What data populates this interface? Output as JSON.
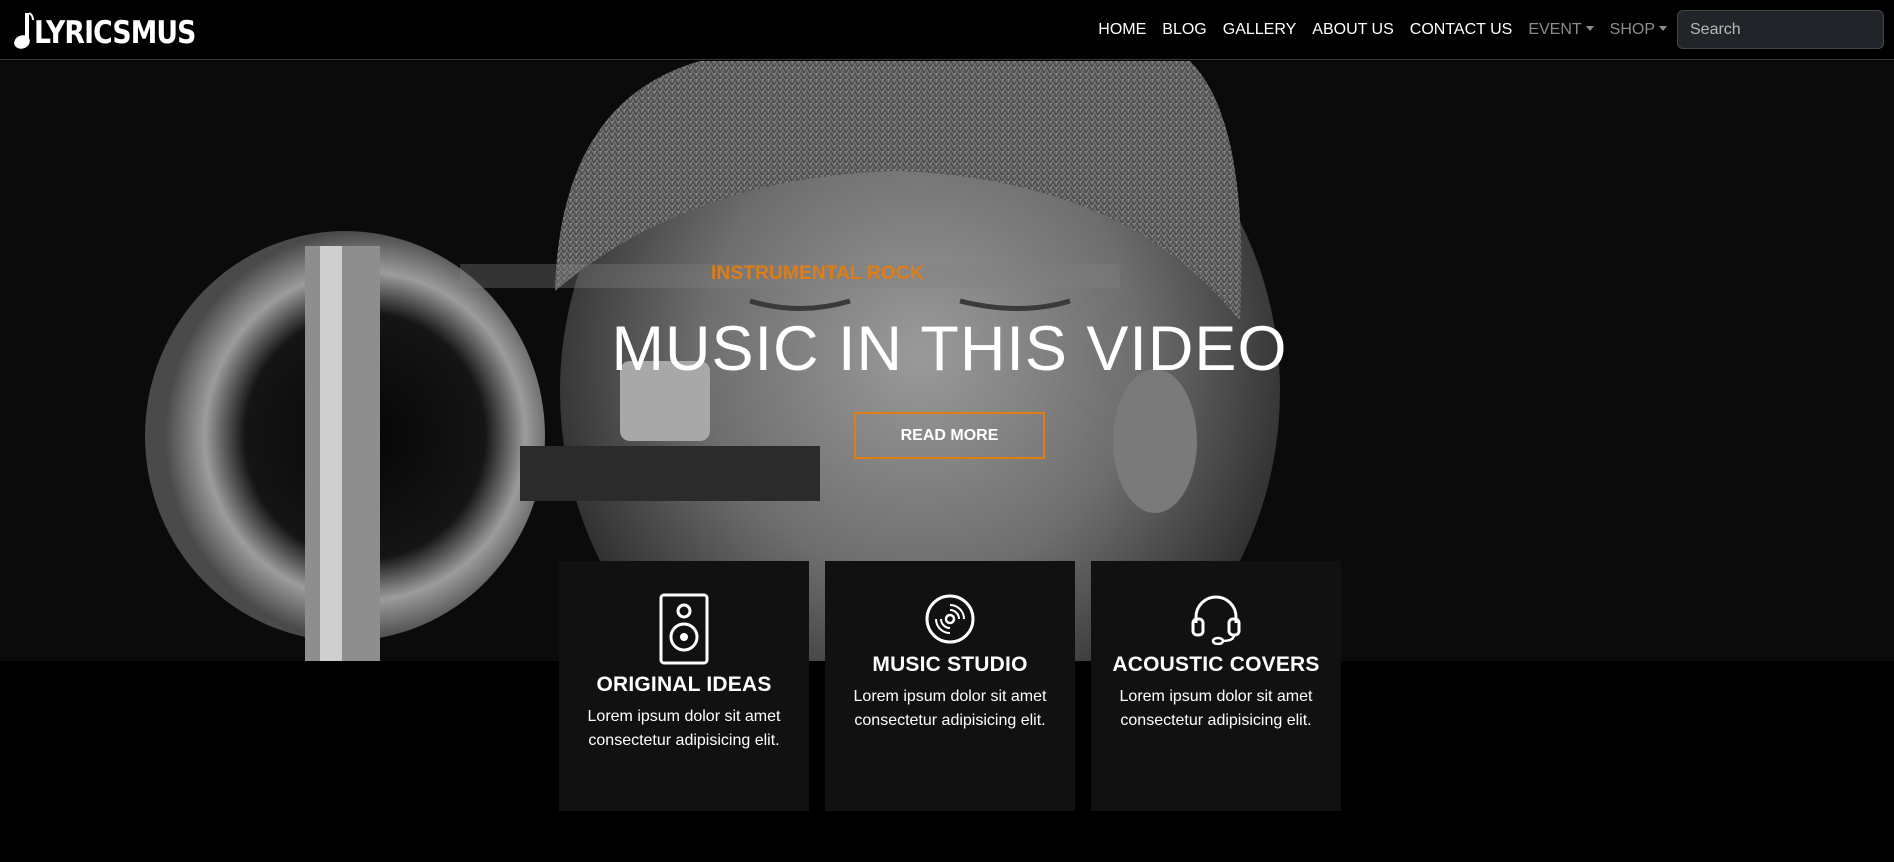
{
  "brand": {
    "name": "LYRICSMUS"
  },
  "nav": {
    "links": [
      {
        "label": "HOME"
      },
      {
        "label": "BLOG"
      },
      {
        "label": "GALLERY"
      },
      {
        "label": "ABOUT US"
      },
      {
        "label": "CONTACT US"
      }
    ],
    "dropdowns": [
      {
        "label": "EVENT"
      },
      {
        "label": "SHOP"
      }
    ],
    "search": {
      "placeholder": "Search"
    }
  },
  "hero": {
    "eyebrow": "INSTRUMENTAL ROCK",
    "title": "MUSIC IN THIS VIDEO",
    "button_label": "READ MORE",
    "accent_color": "#e07d14"
  },
  "features": [
    {
      "icon": "speaker-icon",
      "title": "ORIGINAL IDEAS",
      "text": "Lorem ipsum dolor sit amet consectetur adipisicing elit."
    },
    {
      "icon": "vinyl-disc-icon",
      "title": "MUSIC STUDIO",
      "text": "Lorem ipsum dolor sit amet consectetur adipisicing elit."
    },
    {
      "icon": "headset-icon",
      "title": "ACOUSTIC COVERS",
      "text": "Lorem ipsum dolor sit amet consectetur adipisicing elit."
    }
  ]
}
